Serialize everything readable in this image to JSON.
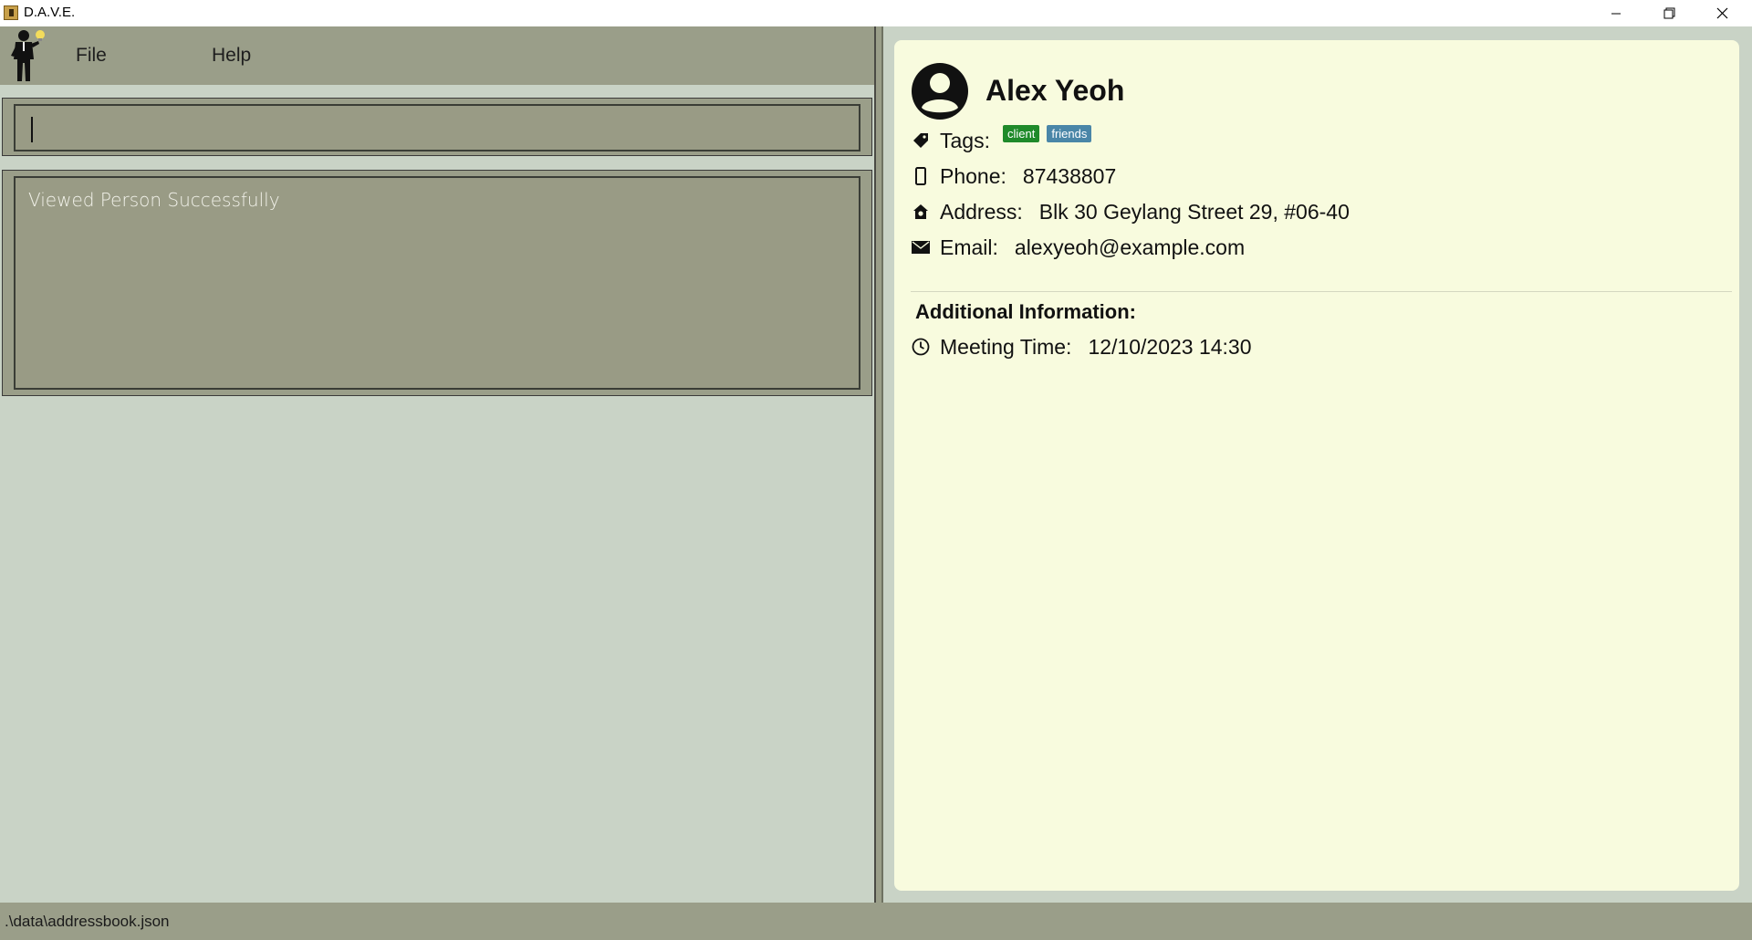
{
  "window": {
    "title": "D.A.V.E.",
    "min_icon": "minimize-icon",
    "max_icon": "restore-icon",
    "close_icon": "close-icon"
  },
  "menu": {
    "file_label": "File",
    "help_label": "Help",
    "logo_icon": "businessman-lightbulb-logo"
  },
  "command_box": {
    "value": ""
  },
  "result": {
    "text": "Viewed Person Successfully"
  },
  "person": {
    "name": "Alex Yeoh",
    "tags_label": "Tags:",
    "tags": [
      {
        "name": "client",
        "color": "#1f8a2a"
      },
      {
        "name": "friends",
        "color": "#4a86a8"
      }
    ],
    "phone_label": "Phone:",
    "phone": "87438807",
    "address_label": "Address:",
    "address": "Blk 30 Geylang Street 29, #06-40",
    "email_label": "Email:",
    "email": "alexyeoh@example.com",
    "additional_title": "Additional Information:",
    "meeting_label": "Meeting Time:",
    "meeting_time": "12/10/2023 14:30"
  },
  "status": {
    "path": ".\\data\\addressbook.json"
  },
  "colors": {
    "panel": "#9a9e89",
    "background": "#c9d3c6",
    "card": "#f8fbde"
  }
}
